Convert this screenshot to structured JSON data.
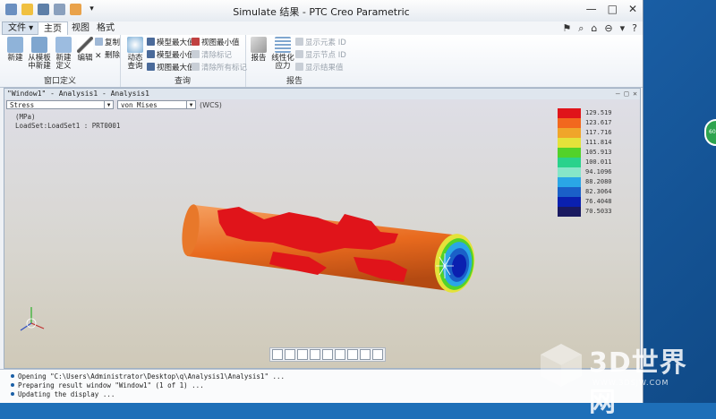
{
  "window": {
    "title": "Simulate 结果 - PTC Creo Parametric"
  },
  "menu_tabs": [
    {
      "label": "文件 ▾"
    },
    {
      "label": "主页"
    },
    {
      "label": "视图"
    },
    {
      "label": "格式"
    }
  ],
  "ribbon": {
    "window_def": {
      "label": "窗口定义",
      "new": "新建",
      "from_template": "从模板\n中新建",
      "new_def": "新建\n定义",
      "edit": "编辑",
      "copy": "复制",
      "delete": "删除"
    },
    "query": {
      "label": "查询",
      "dynamic_query": "动态\n查询",
      "model_max": "模型最大值",
      "model_min": "模型最小值",
      "view_max": "视图最大值",
      "view_min": "视图最小值",
      "clear_mark": "清除标记",
      "clear_all_marks": "清除所有标记"
    },
    "report": {
      "label": "报告",
      "report": "报告",
      "linearize": "线性化\n应力",
      "show_element_id": "显示元素 ID",
      "show_node_id": "显示节点 ID",
      "show_result_value": "显示结果值"
    }
  },
  "pane": {
    "title": "\"Window1\" - Analysis1 - Analysis1",
    "quantity": "Stress",
    "component": "von Mises",
    "coord": "(WCS)",
    "units": "(MPa)",
    "loadset": "LoadSet:LoadSet1 : PRT0001"
  },
  "legend": {
    "values": [
      "129.519",
      "123.617",
      "117.716",
      "111.814",
      "105.913",
      "100.011",
      "94.1096",
      "88.2080",
      "82.3064",
      "76.4048",
      "70.5033"
    ],
    "colors": [
      "#e0141a",
      "#f2681e",
      "#f0a52a",
      "#e4e23a",
      "#52d22a",
      "#2ad28c",
      "#86e6c8",
      "#2aa6e6",
      "#1a60c8",
      "#0a20b0",
      "#1a1a60"
    ]
  },
  "status": {
    "messages": [
      "Opening \"C:\\Users\\Administrator\\Desktop\\q\\Analysis1\\Analysis1\" ...",
      "Preparing result window \"Window1\" (1 of 1) ...",
      "Updating the display ..."
    ]
  },
  "watermark": {
    "brand": "3D世界网",
    "url": "WWW.3DSJW.COM"
  },
  "gadget": {
    "text": "60%"
  }
}
